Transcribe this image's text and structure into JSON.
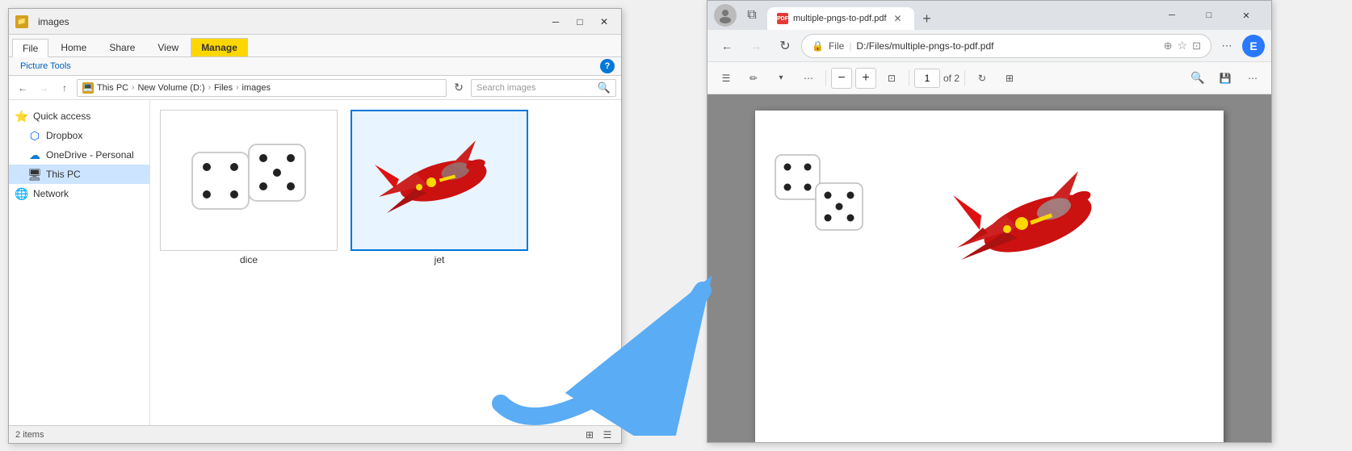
{
  "explorer": {
    "title": "images",
    "title_bar": {
      "icon_label": "📁",
      "tabs": {
        "manage_label": "Manage",
        "title": "images"
      },
      "win_btns": {
        "minimize": "─",
        "maximize": "□",
        "close": "✕"
      }
    },
    "ribbon": {
      "tabs": [
        "File",
        "Home",
        "Share",
        "View",
        "Picture Tools"
      ],
      "active_tab": "Picture Tools",
      "manage_label": "Manage",
      "help_label": "?"
    },
    "address": {
      "path_segments": [
        "This PC",
        "New Volume (D:)",
        "Files",
        "images"
      ],
      "search_placeholder": "Search images"
    },
    "sidebar": {
      "items": [
        {
          "id": "quick-access",
          "label": "Quick access",
          "icon": "⭐"
        },
        {
          "id": "dropbox",
          "label": "Dropbox",
          "icon": "🔵"
        },
        {
          "id": "onedrive",
          "label": "OneDrive - Personal",
          "icon": "☁"
        },
        {
          "id": "this-pc",
          "label": "This PC",
          "icon": "💻"
        },
        {
          "id": "network",
          "label": "Network",
          "icon": "🌐"
        }
      ]
    },
    "files": [
      {
        "id": "dice",
        "name": "dice",
        "type": "dice"
      },
      {
        "id": "jet",
        "name": "jet",
        "type": "jet"
      }
    ],
    "status": {
      "count": "2",
      "items_label": "items"
    }
  },
  "browser": {
    "tab": {
      "favicon": "PDF",
      "label": "multiple-pngs-to-pdf.pdf",
      "close_btn": "✕"
    },
    "new_tab_btn": "+",
    "win_btns": {
      "minimize": "─",
      "maximize": "□",
      "close": "✕"
    },
    "toolbar": {
      "back_btn": "←",
      "forward_btn": "→",
      "refresh_btn": "↻",
      "address": {
        "protocol": "File",
        "url": "D:/Files/multiple-pngs-to-pdf.pdf"
      },
      "zoom_btn": "⊕",
      "bookmark_btn": "☆",
      "split_btn": "⊡",
      "more_btn": "⋯",
      "user_icon": "👤"
    },
    "pdf_toolbar": {
      "toc_btn": "☰",
      "draw_btn": "✏",
      "draw_arrow": "▾",
      "more_btn": "⋯",
      "zoom_out": "−",
      "zoom_in": "+",
      "fit_btn": "⊡",
      "page_current": "1",
      "page_total": "of 2",
      "rotate_btn": "↻",
      "layout_btn": "⊞",
      "search_btn": "🔍",
      "save_btn": "💾",
      "more2_btn": "⋯"
    }
  },
  "arrow": {
    "label": "blue arrow pointing right"
  }
}
